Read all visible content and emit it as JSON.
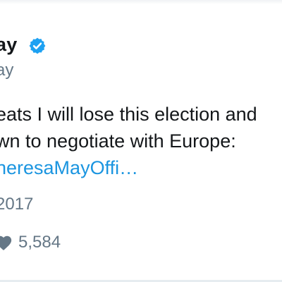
{
  "tweet": {
    "display_name": "ay",
    "handle": "ay",
    "text_line_1": "eats I will lose this election and",
    "text_line_2": "wn to negotiate with Europe:",
    "link_text": "heresaMayOffi…",
    "timestamp": "2017",
    "likes_count": "5,584"
  },
  "icons": {
    "verified": "verified-badge-icon",
    "likes": "heart-icon"
  },
  "colors": {
    "link": "#1b95e0",
    "verified": "#1da1f2",
    "secondary_text": "#657786",
    "primary_text": "#14171a"
  }
}
